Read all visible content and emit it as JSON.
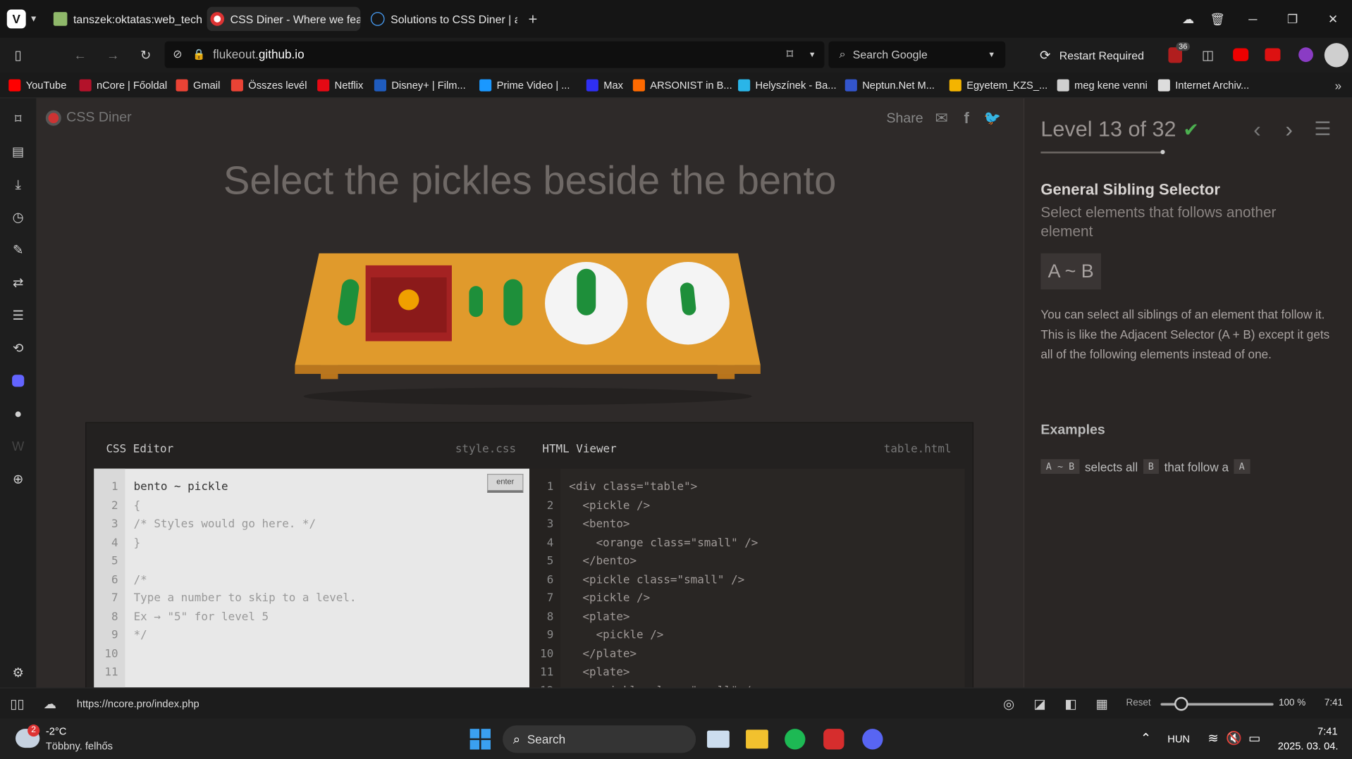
{
  "tabs": [
    {
      "title": "tanszek:oktatas:web_techno"
    },
    {
      "title": "CSS Diner - Where we feast"
    },
    {
      "title": "Solutions to CSS Diner | anc"
    }
  ],
  "address": {
    "url_plain": "flukeout.",
    "url_bold": "github.io",
    "search_placeholder": "Search Google",
    "restart_label": "Restart Required",
    "badge_count": "36"
  },
  "bookmarks": [
    {
      "label": "YouTube",
      "color": "#ff0000"
    },
    {
      "label": "nCore | Főoldal",
      "color": "#b3122a"
    },
    {
      "label": "Gmail",
      "color": "#ea4335"
    },
    {
      "label": "Összes levél",
      "color": "#ea4335"
    },
    {
      "label": "Netflix",
      "color": "#e50914"
    },
    {
      "label": "Disney+ | Film...",
      "color": "#1f5cbf"
    },
    {
      "label": "Prime Video | ...",
      "color": "#1a98ff"
    },
    {
      "label": "Max",
      "color": "#2f2ff2"
    },
    {
      "label": "ARSONIST in B...",
      "color": "#ff6a00"
    },
    {
      "label": "Helyszínek - Ba...",
      "color": "#2ab5e8"
    },
    {
      "label": "Neptun.Net M...",
      "color": "#3355cc"
    },
    {
      "label": "Egyetem_KZS_...",
      "color": "#f4b400"
    },
    {
      "label": "meg kene venni",
      "color": "#cfcfcf"
    },
    {
      "label": "Internet Archiv...",
      "color": "#dddddd"
    }
  ],
  "game": {
    "logo": "CSS Diner",
    "share": "Share",
    "instruction": "Select the pickles beside the bento",
    "level_text": "Level 13 of 32",
    "selector_name": "General Sibling Selector",
    "selector_desc": "Select elements that follows another element",
    "syntax": "A ~ B",
    "explanation": "You can select all siblings of an element that follow it. This is like the Adjacent Selector (A + B) except it gets all of the following elements instead of one.",
    "examples_title": "Examples",
    "example": {
      "code1": "A ~ B",
      "t1": "selects all",
      "code2": "B",
      "t2": "that follow a",
      "code3": "A"
    }
  },
  "css_editor": {
    "title": "CSS Editor",
    "file": "style.css",
    "enter": "enter",
    "lines": [
      "bento ~ pickle",
      "{",
      "/* Styles would go here. */",
      "}",
      "",
      "/*",
      "Type a number to skip to a level.",
      "Ex → \"5\" for level 5",
      "*/",
      "",
      ""
    ]
  },
  "html_viewer": {
    "title": "HTML Viewer",
    "file": "table.html",
    "lines": [
      "<div class=\"table\">",
      "  <pickle />",
      "  <bento>",
      "    <orange class=\"small\" />",
      "  </bento>",
      "  <pickle class=\"small\" />",
      "  <pickle />",
      "  <plate>",
      "    <pickle />",
      "  </plate>",
      "  <plate>",
      "    <pickle class=\"small\" />"
    ]
  },
  "status": {
    "url": "https://ncore.pro/index.php",
    "reset": "Reset",
    "zoom": "100 %",
    "time": "7:41",
    "zoom_fraction": 0.18
  },
  "taskbar": {
    "temp": "-2°C",
    "weather": "Többny. felhős",
    "weather_badge": "2",
    "search": "Search",
    "lang": "HUN",
    "time": "7:41",
    "date": "2025. 03. 04."
  },
  "colors": {
    "accent": "#dc3f3f",
    "check": "#4cb050",
    "pickle": "#1e8f3a",
    "table": "#e09a2c",
    "bento": "#a42222",
    "orange": "#f0a000"
  }
}
